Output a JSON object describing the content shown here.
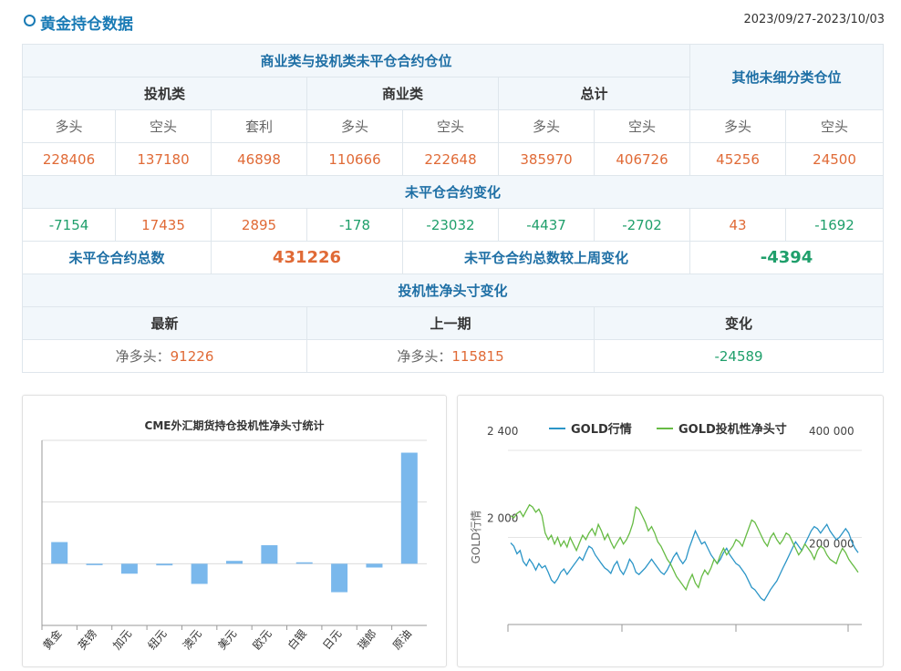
{
  "header": {
    "title": "黄金持仓数据",
    "date_range": "2023/09/27-2023/10/03"
  },
  "table": {
    "main_header": "商业类与投机类未平仓合约仓位",
    "other_header": "其他未细分类仓位",
    "group_spec": "投机类",
    "group_comm": "商业类",
    "group_total": "总计",
    "col_long": "多头",
    "col_short": "空头",
    "col_spread": "套利",
    "values": [
      "228406",
      "137180",
      "46898",
      "110666",
      "222648",
      "385970",
      "406726",
      "45256",
      "24500"
    ],
    "change_header": "未平仓合约变化",
    "changes": [
      "-7154",
      "17435",
      "2895",
      "-178",
      "-23032",
      "-4437",
      "-2702",
      "43",
      "-1692"
    ],
    "oi_label": "未平仓合约总数",
    "oi_value": "431226",
    "oi_change_label": "未平仓合约总数较上周变化",
    "oi_change_value": "-4394",
    "net_header": "投机性净头寸变化",
    "net_latest_label": "最新",
    "net_prev_label": "上一期",
    "net_change_label": "变化",
    "net_prefix": "净多头：",
    "net_latest": "91226",
    "net_prev": "115815",
    "net_change": "-24589"
  },
  "chart_data": [
    {
      "type": "bar",
      "title": "CME外汇期货持仓投机性净头寸统计",
      "categories": [
        "黄金",
        "英镑",
        "加元",
        "纽元",
        "澳元",
        "美元",
        "欧元",
        "白银",
        "日元",
        "瑞郎",
        "原油"
      ],
      "values": [
        91226,
        -6000,
        -42000,
        -7000,
        -85000,
        12000,
        78000,
        6000,
        -120000,
        -16000,
        468000
      ],
      "ylim": [
        -260000,
        520000
      ],
      "grid": true,
      "colors": {
        "bar": "#7ab8ec",
        "grid": "#dcdcdc",
        "axis": "#999999"
      }
    },
    {
      "type": "line",
      "legend": [
        "GOLD行情",
        "GOLD投机性净头寸"
      ],
      "legend_placement": "top",
      "ylabel": "GOLD行情",
      "left_ticks": [
        "2 400",
        "2 000"
      ],
      "right_ticks": [
        "400 000",
        "200 000"
      ],
      "left_range": [
        1600,
        2400
      ],
      "right_range": [
        0,
        400000
      ],
      "series": [
        {
          "name": "GOLD行情",
          "color": "#2b95c7",
          "values": [
            1975,
            1960,
            1925,
            1940,
            1890,
            1870,
            1900,
            1880,
            1850,
            1880,
            1860,
            1870,
            1840,
            1805,
            1790,
            1810,
            1840,
            1855,
            1830,
            1850,
            1870,
            1890,
            1910,
            1895,
            1930,
            1960,
            1950,
            1920,
            1900,
            1880,
            1860,
            1850,
            1835,
            1870,
            1890,
            1850,
            1830,
            1860,
            1900,
            1880,
            1840,
            1830,
            1845,
            1860,
            1880,
            1900,
            1880,
            1860,
            1840,
            1830,
            1850,
            1880,
            1910,
            1930,
            1900,
            1880,
            1900,
            1950,
            1990,
            2030,
            2000,
            1970,
            1980,
            1950,
            1920,
            1900,
            1880,
            1900,
            1930,
            1950,
            1920,
            1900,
            1880,
            1870,
            1850,
            1830,
            1800,
            1770,
            1760,
            1740,
            1720,
            1710,
            1735,
            1760,
            1780,
            1800,
            1830,
            1860,
            1890,
            1920,
            1950,
            1980,
            1960,
            1940,
            1970,
            2000,
            2030,
            2050,
            2040,
            2020,
            2040,
            2060,
            2030,
            2010,
            1990,
            2000,
            2020,
            2040,
            2020,
            1980,
            1950,
            1930
          ]
        },
        {
          "name": "GOLD投机性净头寸",
          "color": "#66bb44",
          "values": [
            250000,
            245000,
            255000,
            260000,
            248000,
            262000,
            275000,
            270000,
            258000,
            265000,
            250000,
            210000,
            195000,
            205000,
            185000,
            200000,
            180000,
            192000,
            178000,
            200000,
            185000,
            170000,
            188000,
            205000,
            195000,
            210000,
            220000,
            205000,
            230000,
            215000,
            195000,
            208000,
            190000,
            175000,
            188000,
            200000,
            185000,
            195000,
            210000,
            232000,
            270000,
            265000,
            250000,
            235000,
            215000,
            225000,
            210000,
            190000,
            180000,
            165000,
            150000,
            140000,
            125000,
            110000,
            100000,
            90000,
            80000,
            100000,
            115000,
            95000,
            85000,
            110000,
            125000,
            115000,
            130000,
            150000,
            140000,
            160000,
            175000,
            160000,
            170000,
            180000,
            195000,
            190000,
            180000,
            200000,
            220000,
            240000,
            235000,
            220000,
            205000,
            190000,
            180000,
            200000,
            210000,
            195000,
            185000,
            195000,
            210000,
            205000,
            190000,
            175000,
            160000,
            170000,
            185000,
            175000,
            165000,
            150000,
            170000,
            180000,
            175000,
            160000,
            150000,
            145000,
            140000,
            160000,
            175000,
            165000,
            150000,
            140000,
            130000,
            120000
          ]
        }
      ]
    }
  ]
}
